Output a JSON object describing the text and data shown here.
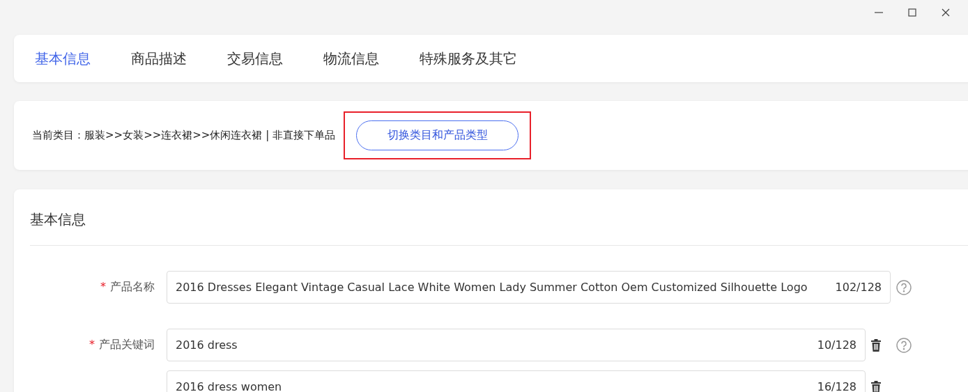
{
  "window": {
    "controls": [
      {
        "kind": "minimize"
      },
      {
        "kind": "maximize"
      },
      {
        "kind": "close"
      }
    ]
  },
  "tabs": [
    {
      "label": "基本信息",
      "selected": true
    },
    {
      "label": "商品描述",
      "selected": false
    },
    {
      "label": "交易信息",
      "selected": false
    },
    {
      "label": "物流信息",
      "selected": false
    },
    {
      "label": "特殊服务及其它",
      "selected": false
    }
  ],
  "category": {
    "text": "当前类目：服装>>女装>>连衣裙>>休闲连衣裙 | 非直接下单品",
    "button": "切换类目和产品类型",
    "highlighted": true
  },
  "section": {
    "title": "基本信息",
    "fields": [
      {
        "label": "产品名称",
        "required_mark": "*",
        "value": "2016 Dresses Elegant Vintage Casual Lace White Women Lady Summer Cotton Oem Customized Silhouette Logo",
        "count": "102/128",
        "deletable": false,
        "help": true
      },
      {
        "label": "产品关键词",
        "required_mark": "*",
        "value": "2016 dress",
        "count": "10/128",
        "deletable": true,
        "help": true
      },
      {
        "value": "2016 dress women",
        "count": "16/128",
        "deletable": true,
        "help": false
      }
    ]
  }
}
